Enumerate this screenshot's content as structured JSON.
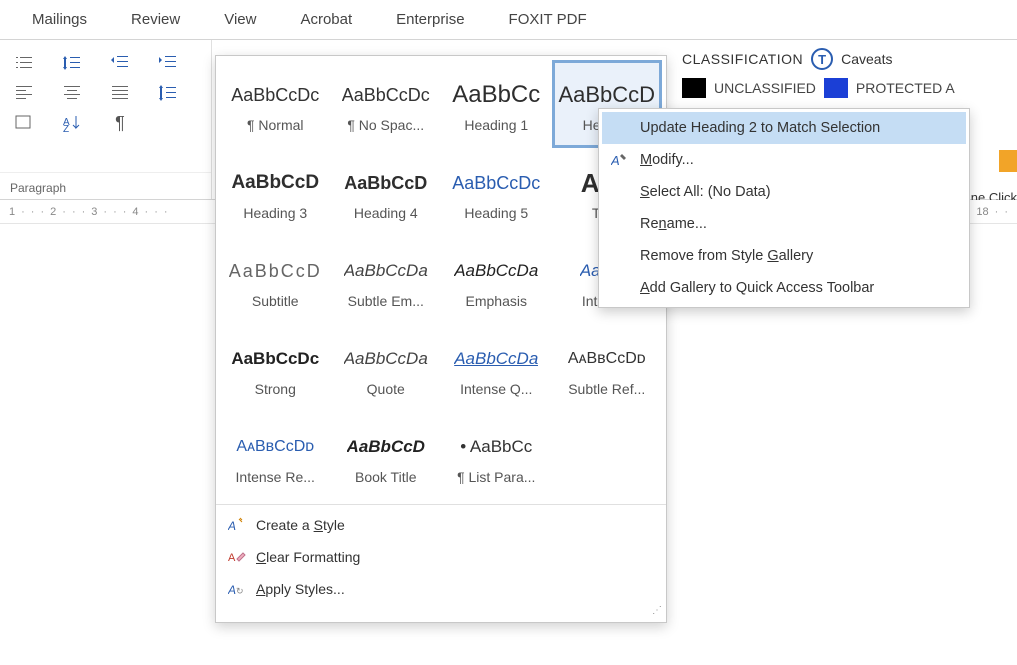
{
  "ribbon": {
    "tabs": [
      "Mailings",
      "Review",
      "View",
      "Acrobat",
      "Enterprise",
      "FOXIT PDF"
    ],
    "paragraph_label": "Paragraph"
  },
  "classification": {
    "label": "CLASSIFICATION",
    "caveats": "Caveats",
    "unclassified": "UNCLASSIFIED",
    "protected": "PROTECTED A",
    "swatch_black": "#000000",
    "swatch_blue": "#1b3fd6",
    "one_click": "ne Click"
  },
  "ruler": {
    "left_nums": [
      "1",
      "2",
      "3",
      "4"
    ],
    "right_num": "18"
  },
  "styles": [
    {
      "preview": "AaBbCcDc",
      "name": "¶ Normal",
      "weight": "normal",
      "color": "#333",
      "italic": false,
      "size": 18
    },
    {
      "preview": "AaBbCcDc",
      "name": "¶ No Spac...",
      "weight": "normal",
      "color": "#333",
      "italic": false,
      "size": 18
    },
    {
      "preview": "AaBbCc",
      "name": "Heading 1",
      "weight": "normal",
      "color": "#2e2e2e",
      "italic": false,
      "size": 24
    },
    {
      "preview": "AaBbCcD",
      "name": "Headi...",
      "weight": "normal",
      "color": "#2e2e2e",
      "italic": false,
      "size": 22,
      "selected": true
    },
    {
      "preview": "AaBbCcD",
      "name": "Heading 3",
      "weight": "bold",
      "color": "#2e2e2e",
      "italic": false,
      "size": 19
    },
    {
      "preview": "AaBbCcD",
      "name": "Heading 4",
      "weight": "bold",
      "color": "#2e2e2e",
      "italic": false,
      "size": 18
    },
    {
      "preview": "AaBbCcDc",
      "name": "Heading 5",
      "weight": "normal",
      "color": "#2a5db0",
      "italic": false,
      "size": 18
    },
    {
      "preview": "AaB",
      "name": "Titl...",
      "weight": "bold",
      "color": "#2e2e2e",
      "italic": false,
      "size": 26
    },
    {
      "preview": "AaBbCcD",
      "name": "Subtitle",
      "weight": "normal",
      "color": "#666",
      "italic": false,
      "size": 18,
      "spaced": true
    },
    {
      "preview": "AaBbCcDa",
      "name": "Subtle Em...",
      "weight": "normal",
      "color": "#444",
      "italic": true,
      "size": 17
    },
    {
      "preview": "AaBbCcDa",
      "name": "Emphasis",
      "weight": "normal",
      "color": "#222",
      "italic": true,
      "size": 17
    },
    {
      "preview": "AaBbC",
      "name": "Intens...",
      "weight": "normal",
      "color": "#2a5db0",
      "italic": true,
      "size": 17
    },
    {
      "preview": "AaBbCcDc",
      "name": "Strong",
      "weight": "bold",
      "color": "#222",
      "italic": false,
      "size": 17
    },
    {
      "preview": "AaBbCcDa",
      "name": "Quote",
      "weight": "normal",
      "color": "#444",
      "italic": true,
      "size": 17
    },
    {
      "preview": "AaBbCcDa",
      "name": "Intense Q...",
      "weight": "normal",
      "color": "#2a5db0",
      "italic": true,
      "size": 17,
      "underline": true
    },
    {
      "preview": "AᴀBʙCᴄDᴅ",
      "name": "Subtle Ref...",
      "weight": "normal",
      "color": "#333",
      "italic": false,
      "size": 16
    },
    {
      "preview": "AᴀBʙCᴄDᴅ",
      "name": "Intense Re...",
      "weight": "normal",
      "color": "#2a5db0",
      "italic": false,
      "size": 16
    },
    {
      "preview": "AaBbCcD",
      "name": "Book Title",
      "weight": "bold",
      "color": "#222",
      "italic": true,
      "size": 17
    },
    {
      "preview": "•  AaBbCc",
      "name": "¶ List Para...",
      "weight": "normal",
      "color": "#333",
      "italic": false,
      "size": 17
    }
  ],
  "gallery_footer": {
    "create": "Create a Style",
    "clear": "Clear Formatting",
    "apply": "Apply Styles..."
  },
  "context_menu": {
    "update": "Update Heading 2 to Match Selection",
    "modify": "Modify...",
    "select_all": "Select All: (No Data)",
    "rename": "Rename...",
    "remove": "Remove from Style Gallery",
    "add_qat": "Add Gallery to Quick Access Toolbar"
  }
}
